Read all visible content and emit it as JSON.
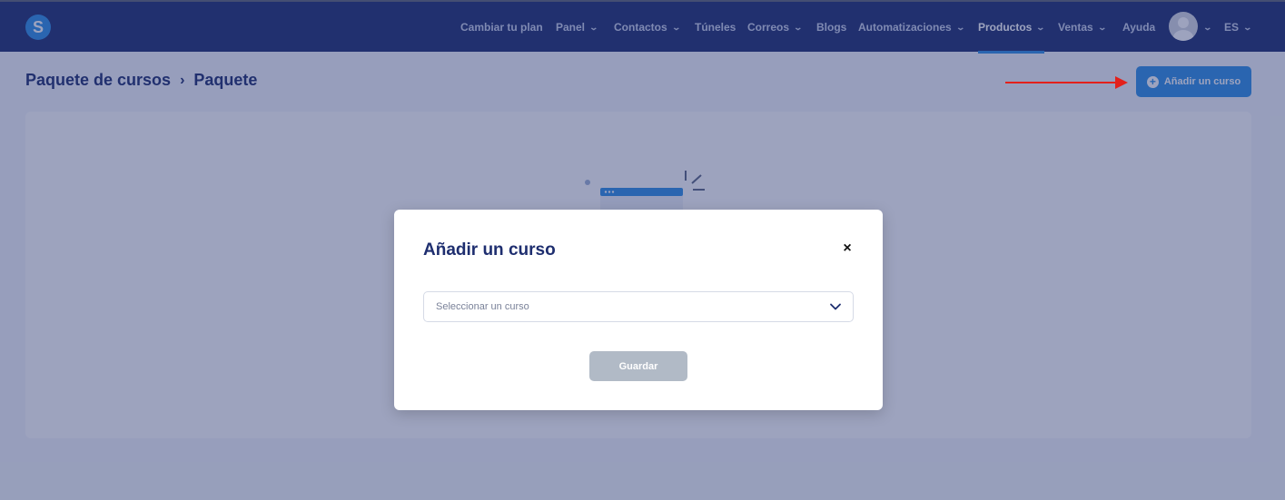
{
  "app": {
    "logo_letter": "S"
  },
  "nav": {
    "items": [
      {
        "label": "Cambiar tu plan",
        "has_dropdown": false,
        "active": false
      },
      {
        "label": "Panel",
        "has_dropdown": true,
        "active": false
      },
      {
        "label": "Contactos",
        "has_dropdown": true,
        "active": false
      },
      {
        "label": "Túneles",
        "has_dropdown": false,
        "active": false
      },
      {
        "label": "Correos",
        "has_dropdown": true,
        "active": false
      },
      {
        "label": "Blogs",
        "has_dropdown": false,
        "active": false
      },
      {
        "label": "Automatizaciones",
        "has_dropdown": true,
        "active": false
      },
      {
        "label": "Productos",
        "has_dropdown": true,
        "active": true
      },
      {
        "label": "Ventas",
        "has_dropdown": true,
        "active": false
      },
      {
        "label": "Ayuda",
        "has_dropdown": false,
        "active": false
      }
    ],
    "language": "ES"
  },
  "breadcrumb": {
    "parent": "Paquete de cursos",
    "current": "Paquete"
  },
  "toolbar": {
    "add_course_label": "Añadir un curso"
  },
  "modal": {
    "title": "Añadir un curso",
    "close_symbol": "×",
    "select_placeholder": "Seleccionar un curso",
    "save_label": "Guardar"
  },
  "colors": {
    "nav_bg": "#1e2e6f",
    "accent": "#2f8fe6",
    "arrow": "#e3201b",
    "disabled_button": "#b1bac6"
  }
}
